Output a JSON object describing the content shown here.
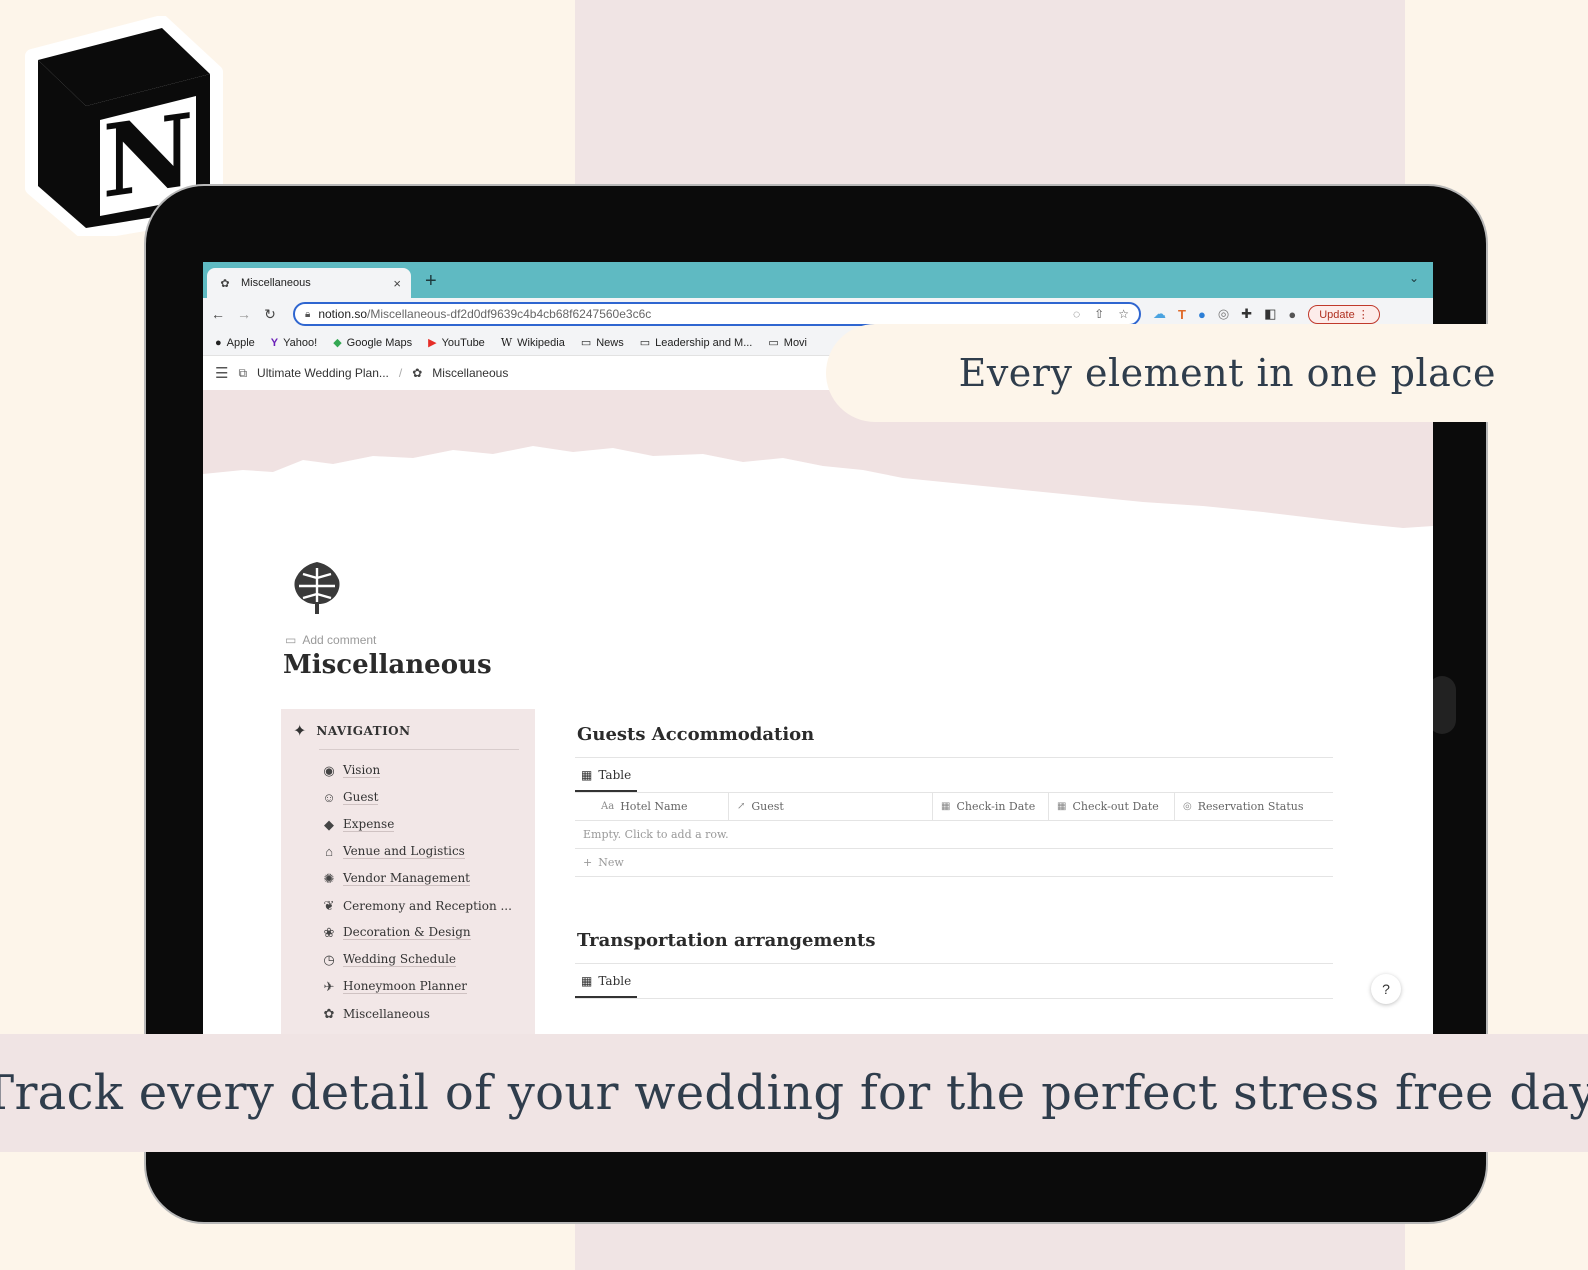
{
  "marketing": {
    "callout": "Every element in one place",
    "banner": "Track every detail of your wedding for the perfect stress free day."
  },
  "browser": {
    "tab_title": "Miscellaneous",
    "tab_close": "×",
    "new_tab": "+",
    "url_domain": "notion.so",
    "url_path": "/Miscellaneous-df2d0df9639c4b4cb68f6247560e3c6c",
    "update_label": "Update",
    "bookmarks": [
      {
        "label": "Apple",
        "icon": "apple-icon",
        "glyph": "●"
      },
      {
        "label": "Yahoo!",
        "icon": "yahoo-icon",
        "glyph": "Y"
      },
      {
        "label": "Google Maps",
        "icon": "maps-pin-icon",
        "glyph": "◆"
      },
      {
        "label": "YouTube",
        "icon": "youtube-icon",
        "glyph": "▶"
      },
      {
        "label": "Wikipedia",
        "icon": "wikipedia-icon",
        "glyph": "W"
      },
      {
        "label": "News",
        "icon": "folder-icon",
        "glyph": "▭"
      },
      {
        "label": "Leadership and M...",
        "icon": "bookmark-icon",
        "glyph": "▭"
      },
      {
        "label": "Movi",
        "icon": "folder-icon",
        "glyph": "▭"
      }
    ]
  },
  "notion": {
    "breadcrumb_parent": "Ultimate Wedding Plan...",
    "breadcrumb_sep": "/",
    "breadcrumb_current": "Miscellaneous",
    "add_comment": "Add comment",
    "page_title": "Miscellaneous",
    "nav_heading": "NAVIGATION",
    "nav_items": [
      {
        "label": "Vision",
        "icon": "eye-icon",
        "glyph": "◉"
      },
      {
        "label": "Guest",
        "icon": "guests-icon",
        "glyph": "☺"
      },
      {
        "label": "Expense",
        "icon": "money-icon",
        "glyph": "◆"
      },
      {
        "label": "Venue and Logistics",
        "icon": "venue-icon",
        "glyph": "⌂"
      },
      {
        "label": "Vendor Management",
        "icon": "vendor-icon",
        "glyph": "✺"
      },
      {
        "label": "Ceremony and Reception ...",
        "icon": "ceremony-icon",
        "glyph": "❦"
      },
      {
        "label": "Decoration & Design",
        "icon": "flower-icon",
        "glyph": "❀"
      },
      {
        "label": "Wedding Schedule",
        "icon": "schedule-icon",
        "glyph": "◷"
      },
      {
        "label": "Honeymoon Planner",
        "icon": "plane-icon",
        "glyph": "✈"
      },
      {
        "label": "Miscellaneous",
        "icon": "leaf-icon",
        "glyph": "✿"
      }
    ],
    "db1": {
      "title": "Guests Accommodation",
      "view": "Table",
      "columns": [
        {
          "label": "Hotel Name",
          "glyph": "Aa"
        },
        {
          "label": "Guest",
          "glyph": "↗"
        },
        {
          "label": "Check-in Date",
          "glyph": "▦"
        },
        {
          "label": "Check-out Date",
          "glyph": "▦"
        },
        {
          "label": "Reservation Status",
          "glyph": "◎"
        }
      ],
      "empty": "Empty. Click to add a row.",
      "new_label": "New"
    },
    "db2": {
      "title": "Transportation arrangements",
      "view": "Table"
    },
    "help": "?"
  }
}
